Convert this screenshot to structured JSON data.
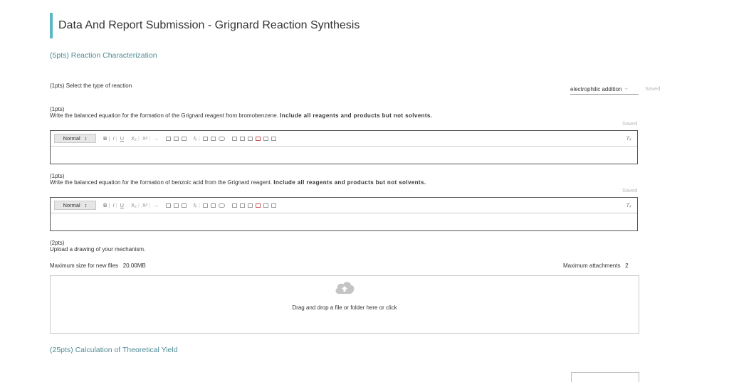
{
  "page": {
    "title": "Data And Report Submission - Grignard Reaction Synthesis"
  },
  "sections": {
    "characterization": "(5pts) Reaction Characterization",
    "yield": "(25pts) Calculation of Theoretical Yield"
  },
  "q1": {
    "points": "(1pts)",
    "text": "Select the type of reaction",
    "selected": "electrophilic addition",
    "status": "Saved"
  },
  "q2": {
    "points": "(1pts)",
    "text": "Write the balanced equation for the formation of the Grignard reagent from bromobenzene.",
    "bold": "Include all reagents and products but not solvents.",
    "status": "Saved"
  },
  "q3": {
    "points": "(1pts)",
    "text": "Write the balanced equation for the formation of benzoic acid from the Grignard reagent.",
    "bold": "Include all reagents and products but not solvents.",
    "status": "Saved"
  },
  "editor": {
    "format": "Normal",
    "format_arrow": "↕",
    "bold": "B",
    "italic": "I",
    "underline": "U",
    "subscript": "X₂",
    "superscript": "X²",
    "arrow": "→",
    "formula": "fₓ",
    "clear": "Tₓ"
  },
  "q4": {
    "points": "(2pts)",
    "text": "Upload a drawing of your mechanism.",
    "max_size_label": "Maximum size for new files",
    "max_size_value": "20.00MB",
    "max_attach_label": "Maximum attachments",
    "max_attach_value": "2",
    "drop_text": "Drag and drop a file or folder here or click"
  },
  "colors": {
    "accent": "#5bb7c3",
    "section": "#4f8b95"
  }
}
